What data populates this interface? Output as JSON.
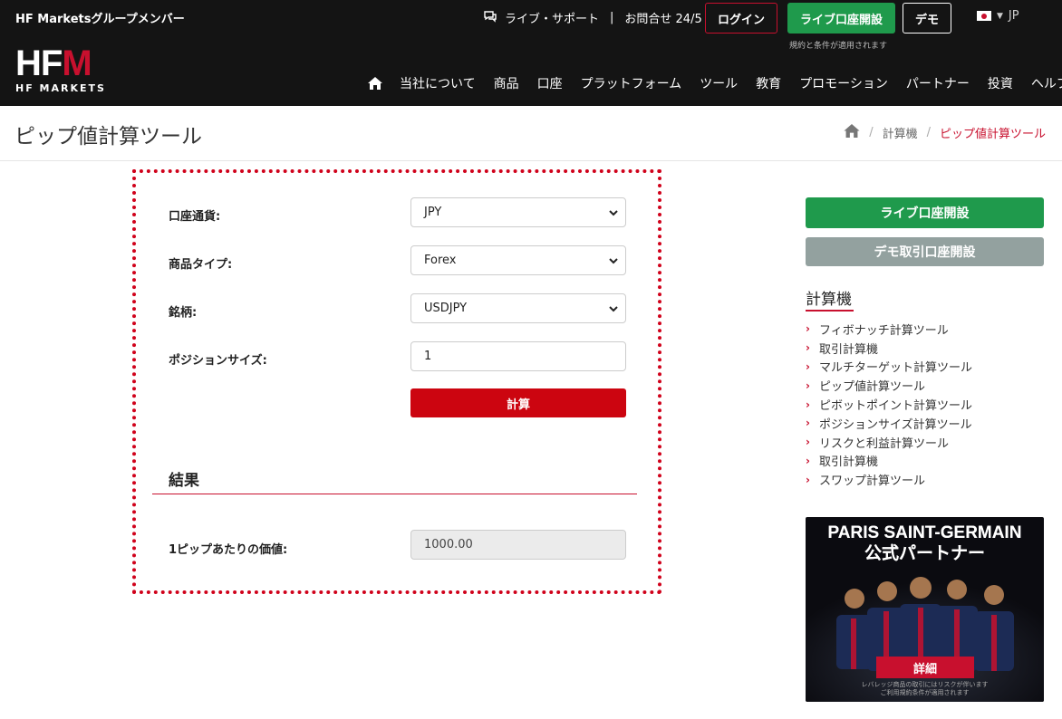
{
  "header": {
    "group_member": "HF Marketsグループメンバー",
    "live_support": "ライブ・サポート",
    "contact": "お問合せ 24/5",
    "login_label": "ログイン",
    "live_account_label": "ライブ口座開設",
    "terms_note": "規約と条件が適用されます",
    "demo_label": "デモ",
    "language": "JP"
  },
  "logo": {
    "mark_main": "HF",
    "mark_accent": "M",
    "sub": "HF MARKETS"
  },
  "nav": {
    "items": [
      "当社について",
      "商品",
      "口座",
      "プラットフォーム",
      "ツール",
      "教育",
      "プロモーション",
      "パートナー",
      "投資",
      "ヘルプ"
    ]
  },
  "page": {
    "title": "ピップ値計算ツール",
    "breadcrumb": [
      "計算機",
      "ピップ値計算ツール"
    ]
  },
  "calculator": {
    "account_currency_label": "口座通貨:",
    "account_currency_value": "JPY",
    "instrument_type_label": "商品タイプ:",
    "instrument_type_value": "Forex",
    "symbol_label": "銘柄:",
    "symbol_value": "USDJPY",
    "position_size_label": "ポジションサイズ:",
    "position_size_value": "1",
    "calculate_label": "計算",
    "result_heading": "結果",
    "pip_value_label": "1ピップあたりの価値:",
    "pip_value_value": "1000.00"
  },
  "sidebar": {
    "live_button": "ライブ口座開設",
    "demo_button": "デモ取引口座開設",
    "title": "計算機",
    "links": [
      "フィボナッチ計算ツール",
      "取引計算機",
      "マルチターゲット計算ツール",
      "ピップ値計算ツール",
      "ピボットポイント計算ツール",
      "ポジションサイズ計算ツール",
      "リスクと利益計算ツール",
      "取引計算機",
      "スワップ計算ツール"
    ]
  },
  "banner": {
    "title_line1": "PARIS SAINT-GERMAIN",
    "title_line2": "公式パートナー",
    "button": "詳細",
    "fine_line1": "レバレッジ商品の取引にはリスクが伴います",
    "fine_line2": "ご利用規約条件が適用されます"
  },
  "colors": {
    "brand_red": "#c8102e",
    "green": "#1f9a4c",
    "header_bg": "#141414"
  },
  "icons": [
    "chat-icon",
    "home-icon",
    "chevron-down-icon",
    "chevron-right-icon"
  ]
}
